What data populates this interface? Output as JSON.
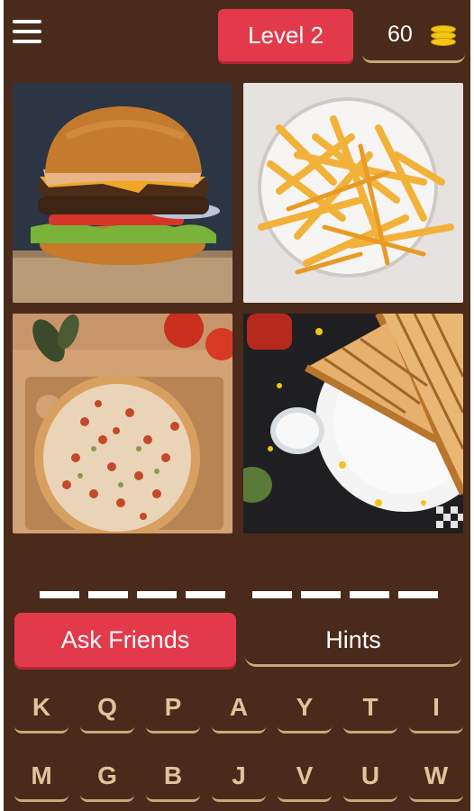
{
  "header": {
    "level_label": "Level 2",
    "coins": "60",
    "menu_icon": "hamburger-menu-icon",
    "coin_icon": "coin-stack-icon"
  },
  "pictures": [
    {
      "name": "burger"
    },
    {
      "name": "french fries"
    },
    {
      "name": "pizza"
    },
    {
      "name": "grilled sandwich"
    }
  ],
  "answer": {
    "word_lengths": [
      4,
      4
    ]
  },
  "actions": {
    "ask_friends_label": "Ask Friends",
    "hints_label": "Hints"
  },
  "keyboard": {
    "row1": [
      "K",
      "Q",
      "P",
      "A",
      "Y",
      "T",
      "I"
    ],
    "row2": [
      "M",
      "G",
      "B",
      "J",
      "V",
      "U",
      "W"
    ]
  },
  "colors": {
    "background": "#4a2a1a",
    "accent_red": "#e23a4b",
    "key_text": "#e0c39a",
    "underline": "#c8a878",
    "coin_gold": "#f3c715"
  }
}
